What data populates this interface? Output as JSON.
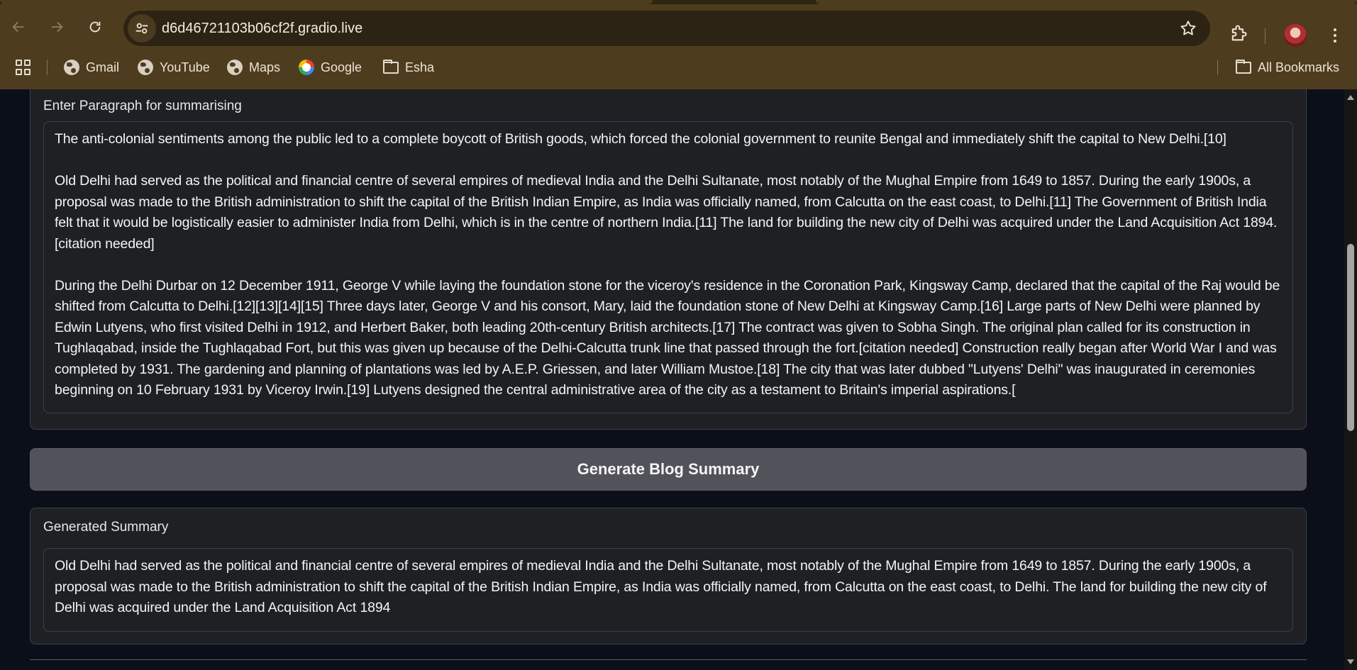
{
  "browser": {
    "url": "d6d46721103b06cf2f.gradio.live",
    "bookmarks": [
      {
        "label": "Gmail",
        "icon": "globe-icon"
      },
      {
        "label": "YouTube",
        "icon": "globe-icon"
      },
      {
        "label": "Maps",
        "icon": "globe-icon"
      },
      {
        "label": "Google",
        "icon": "google-icon"
      },
      {
        "label": "Esha",
        "icon": "folder-icon"
      }
    ],
    "all_bookmarks_label": "All Bookmarks"
  },
  "input_block": {
    "label": "Enter Paragraph for summarising",
    "value": "The anti-colonial sentiments among the public led to a complete boycott of British goods, which forced the colonial government to reunite Bengal and immediately shift the capital to New Delhi.[10]\n\nOld Delhi had served as the political and financial centre of several empires of medieval India and the Delhi Sultanate, most notably of the Mughal Empire from 1649 to 1857. During the early 1900s, a proposal was made to the British administration to shift the capital of the British Indian Empire, as India was officially named, from Calcutta on the east coast, to Delhi.[11] The Government of British India felt that it would be logistically easier to administer India from Delhi, which is in the centre of northern India.[11] The land for building the new city of Delhi was acquired under the Land Acquisition Act 1894.[citation needed]\n\nDuring the Delhi Durbar on 12 December 1911, George V while laying the foundation stone for the viceroy's residence in the Coronation Park, Kingsway Camp, declared that the capital of the Raj would be shifted from Calcutta to Delhi.[12][13][14][15] Three days later, George V and his consort, Mary, laid the foundation stone of New Delhi at Kingsway Camp.[16] Large parts of New Delhi were planned by Edwin Lutyens, who first visited Delhi in 1912, and Herbert Baker, both leading 20th-century British architects.[17] The contract was given to Sobha Singh. The original plan called for its construction in Tughlaqabad, inside the Tughlaqabad Fort, but this was given up because of the Delhi-Calcutta trunk line that passed through the fort.[citation needed] Construction really began after World War I and was completed by 1931. The gardening and planning of plantations was led by A.E.P. Griessen, and later William Mustoe.[18] The city that was later dubbed \"Lutyens' Delhi\" was inaugurated in ceremonies beginning on 10 February 1931 by Viceroy Irwin.[19] Lutyens designed the central administrative area of the city as a testament to Britain's imperial aspirations.["
  },
  "generate_button": {
    "label": "Generate Blog Summary"
  },
  "output_block": {
    "label": "Generated Summary",
    "value": "Old Delhi had served as the political and financial centre of several empires of medieval India and the Delhi Sultanate, most notably of the Mughal Empire from 1649 to 1857. During the early 1900s, a proposal was made to the British administration to shift the capital of the British Indian Empire, as India was officially named, from Calcutta on the east coast, to Delhi. The land for building the new city of Delhi was acquired under the Land Acquisition Act 1894"
  },
  "colors": {
    "chrome_bg": "#4e3c1e",
    "omnibox_bg": "#2d2314",
    "page_bg": "#0b0f19",
    "block_bg": "#1f2023",
    "button_bg": "#52535a"
  }
}
